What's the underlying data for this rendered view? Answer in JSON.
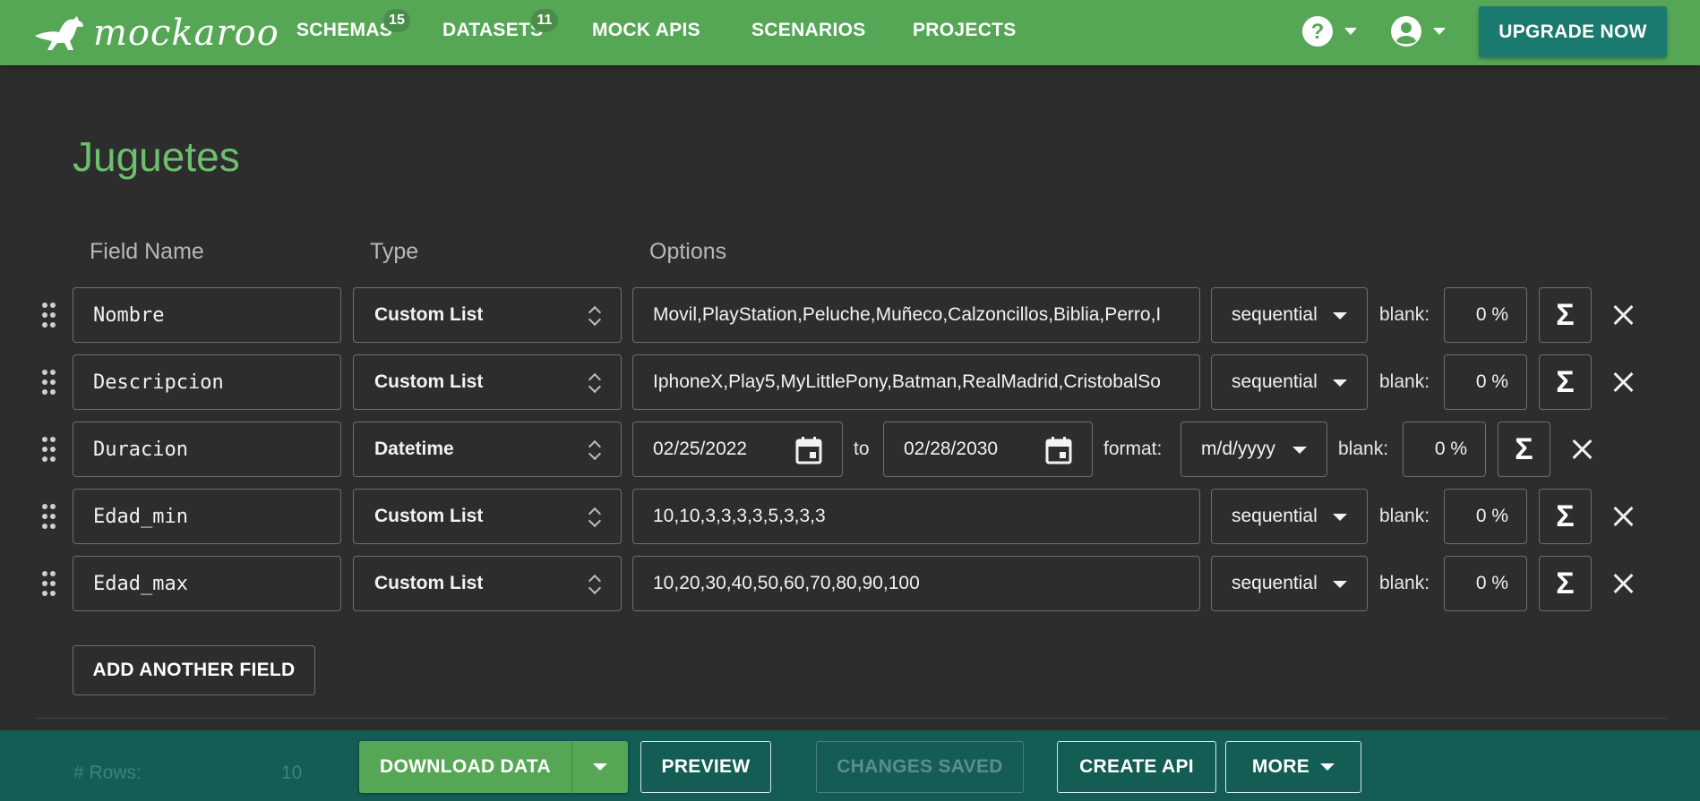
{
  "nav": {
    "brand": "mockaroo",
    "items": [
      {
        "label": "SCHEMAS",
        "badge": "15"
      },
      {
        "label": "DATASETS",
        "badge": "11"
      },
      {
        "label": "MOCK APIS"
      },
      {
        "label": "SCENARIOS"
      },
      {
        "label": "PROJECTS"
      }
    ],
    "help_icon": "help-circle-icon",
    "account_icon": "account-circle-icon",
    "upgrade_label": "UPGRADE NOW"
  },
  "schema": {
    "title": "Juguetes",
    "headers": {
      "field_name": "Field Name",
      "type": "Type",
      "options": "Options"
    },
    "fields": [
      {
        "name": "Nombre",
        "type": "Custom List",
        "values": "Movil,PlayStation,Peluche,Muñeco,Calzoncillos,Biblia,Perro,I",
        "order": "sequential",
        "blank_label": "blank:",
        "blank": "0 %"
      },
      {
        "name": "Descripcion",
        "type": "Custom List",
        "values": "IphoneX,Play5,MyLittlePony,Batman,RealMadrid,CristobalSo",
        "order": "sequential",
        "blank_label": "blank:",
        "blank": "0 %"
      },
      {
        "name": "Duracion",
        "type": "Datetime",
        "from": "02/25/2022",
        "to_label": "to",
        "to": "02/28/2030",
        "format_label": "format:",
        "format": "m/d/yyyy",
        "blank_label": "blank:",
        "blank": "0 %"
      },
      {
        "name": "Edad_min",
        "type": "Custom List",
        "values": "10,10,3,3,3,3,5,3,3,3",
        "order": "sequential",
        "blank_label": "blank:",
        "blank": "0 %"
      },
      {
        "name": "Edad_max",
        "type": "Custom List",
        "values": "10,20,30,40,50,60,70,80,90,100",
        "order": "sequential",
        "blank_label": "blank:",
        "blank": "0 %"
      }
    ],
    "sigma_symbol": "Σ",
    "add_field_label": "ADD ANOTHER FIELD"
  },
  "footer": {
    "rows_label": "# Rows:",
    "rows_value": "10",
    "download_label": "DOWNLOAD DATA",
    "preview_label": "PREVIEW",
    "saved_label": "CHANGES SAVED",
    "create_api_label": "CREATE API",
    "more_label": "MORE"
  },
  "colors": {
    "brand_green": "#55a756",
    "title_green": "#6cbf6d",
    "footer_teal": "#135d54",
    "upgrade_teal": "#1a7a70"
  }
}
